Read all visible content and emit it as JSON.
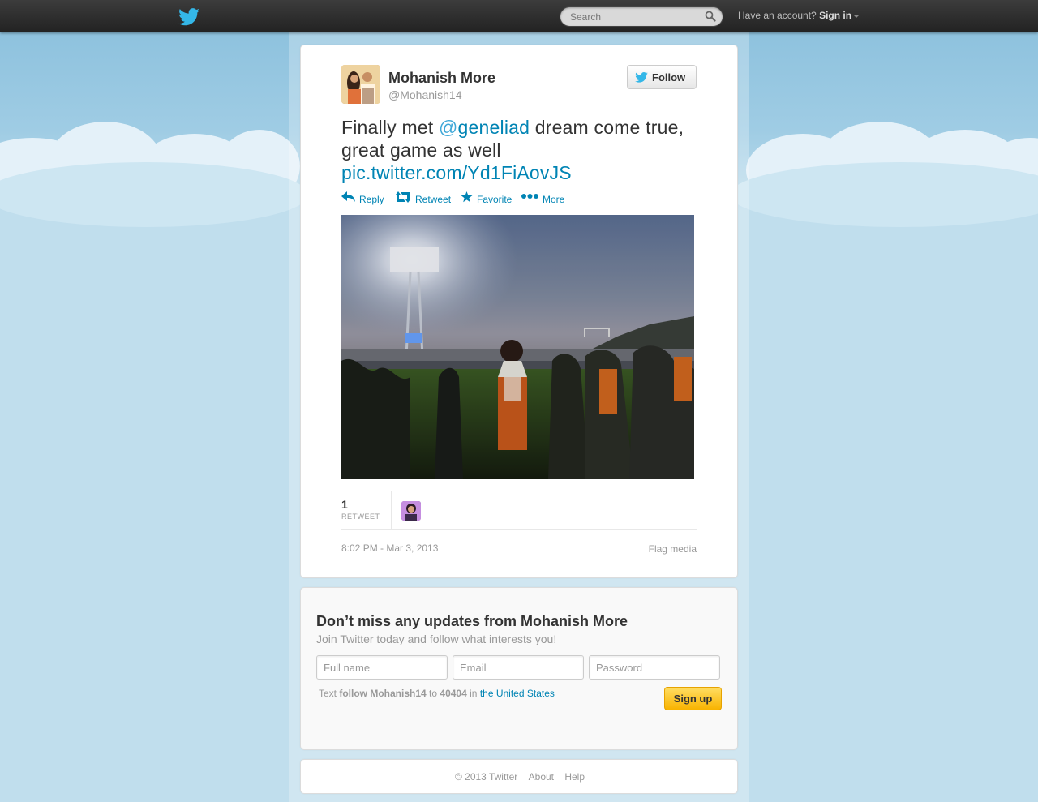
{
  "topbar": {
    "search_placeholder": "Search",
    "account_prompt": "Have an account?",
    "signin_label": "Sign in"
  },
  "tweet": {
    "fullname": "Mohanish More",
    "screenname": "@Mohanish14",
    "follow_label": "Follow",
    "text_before": "Finally met ",
    "mention_at": "@",
    "mention_name": "geneliad",
    "text_after": " dream come true, great game as well ",
    "link": "pic.twitter.com/Yd1FiAovJS",
    "actions": {
      "reply": "Reply",
      "retweet": "Retweet",
      "favorite": "Favorite",
      "more": "More"
    },
    "retweet_count": "1",
    "retweet_label": "RETWEET",
    "timestamp": "8:02 PM - Mar 3, 2013",
    "flag_label": "Flag media"
  },
  "signup": {
    "title": "Don’t miss any updates from Mohanish More",
    "subtitle": "Join Twitter today and follow what interests you!",
    "fullname_placeholder": "Full name",
    "email_placeholder": "Email",
    "password_placeholder": "Password",
    "sms_text": "Text",
    "sms_command": "follow Mohanish14",
    "sms_to": "to",
    "sms_number": "40404",
    "sms_in": "in",
    "sms_country": "the United States",
    "button_label": "Sign up"
  },
  "footer": {
    "copyright": "© 2013 Twitter",
    "about": "About",
    "help": "Help"
  },
  "colors": {
    "link": "#0084b4",
    "topbar": "#222222",
    "sky": "#c0deed",
    "signup_button": "#f8b300"
  },
  "icons": [
    "twitter-bird-icon",
    "search-icon",
    "caret-down-icon",
    "reply-icon",
    "retweet-icon",
    "star-icon",
    "more-dots-icon"
  ]
}
